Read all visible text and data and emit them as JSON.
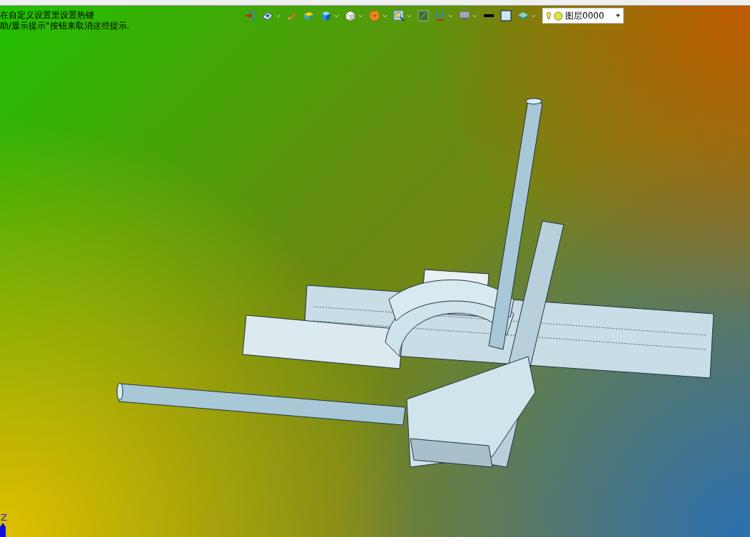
{
  "hints": [
    "在自定义设置里设置热键",
    "助/显示提示\"按钮来取消这些提示."
  ],
  "toolbar": [
    {
      "kind": "plain"
    },
    {
      "kind": "menu"
    },
    {
      "kind": "plain"
    },
    {
      "kind": "plain"
    },
    {
      "kind": "menu"
    },
    {
      "kind": "menu"
    },
    {
      "kind": "menu"
    },
    {
      "kind": "menu"
    },
    {
      "kind": "plain"
    },
    {
      "kind": "menu"
    },
    {
      "kind": "menu"
    },
    {
      "kind": "plain"
    },
    {
      "kind": "plain"
    },
    {
      "kind": "menu"
    }
  ],
  "layer_select": {
    "value": "图层0000"
  },
  "axis": {
    "label": "Z"
  }
}
